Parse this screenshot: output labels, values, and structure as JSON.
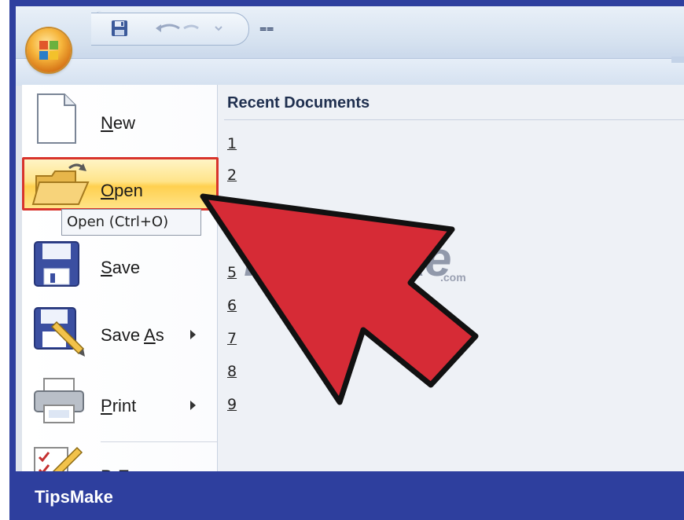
{
  "app": {
    "office_button_icon": "office-orb-icon",
    "qat": {
      "save_icon": "floppy-save-icon",
      "undo_icon": "undo-icon",
      "customize_glyph": "⩵"
    }
  },
  "menu": {
    "items": [
      {
        "id": "new",
        "label": "New",
        "accel": "N",
        "icon": "blank-document-icon",
        "submenu": false
      },
      {
        "id": "open",
        "label": "Open",
        "accel": "O",
        "icon": "open-folder-icon",
        "submenu": false
      },
      {
        "id": "save",
        "label": "Save",
        "accel": "S",
        "icon": "floppy-disk-icon",
        "submenu": false
      },
      {
        "id": "save_as",
        "label": "Save As",
        "accel": "A",
        "icon": "floppy-pencil-icon",
        "submenu": true
      },
      {
        "id": "print",
        "label": "Print",
        "accel": "P",
        "icon": "printer-icon",
        "submenu": true
      },
      {
        "id": "prepare",
        "label": "Prepare",
        "accel": "E",
        "icon": "checklist-pencil-icon",
        "submenu": true
      }
    ],
    "tooltip": "Open (Ctrl+O)"
  },
  "recent": {
    "header": "Recent Documents",
    "numbers": [
      "1",
      "2",
      "5",
      "6",
      "7",
      "8",
      "9"
    ]
  },
  "overlay": {
    "watermark": "TipsMake",
    "watermark_suffix": ".com",
    "arrow_color": "#d62b36",
    "highlight_color": "#d8342c"
  },
  "footer": {
    "brand": "TipsMake",
    "color": "#2e3f9e"
  }
}
